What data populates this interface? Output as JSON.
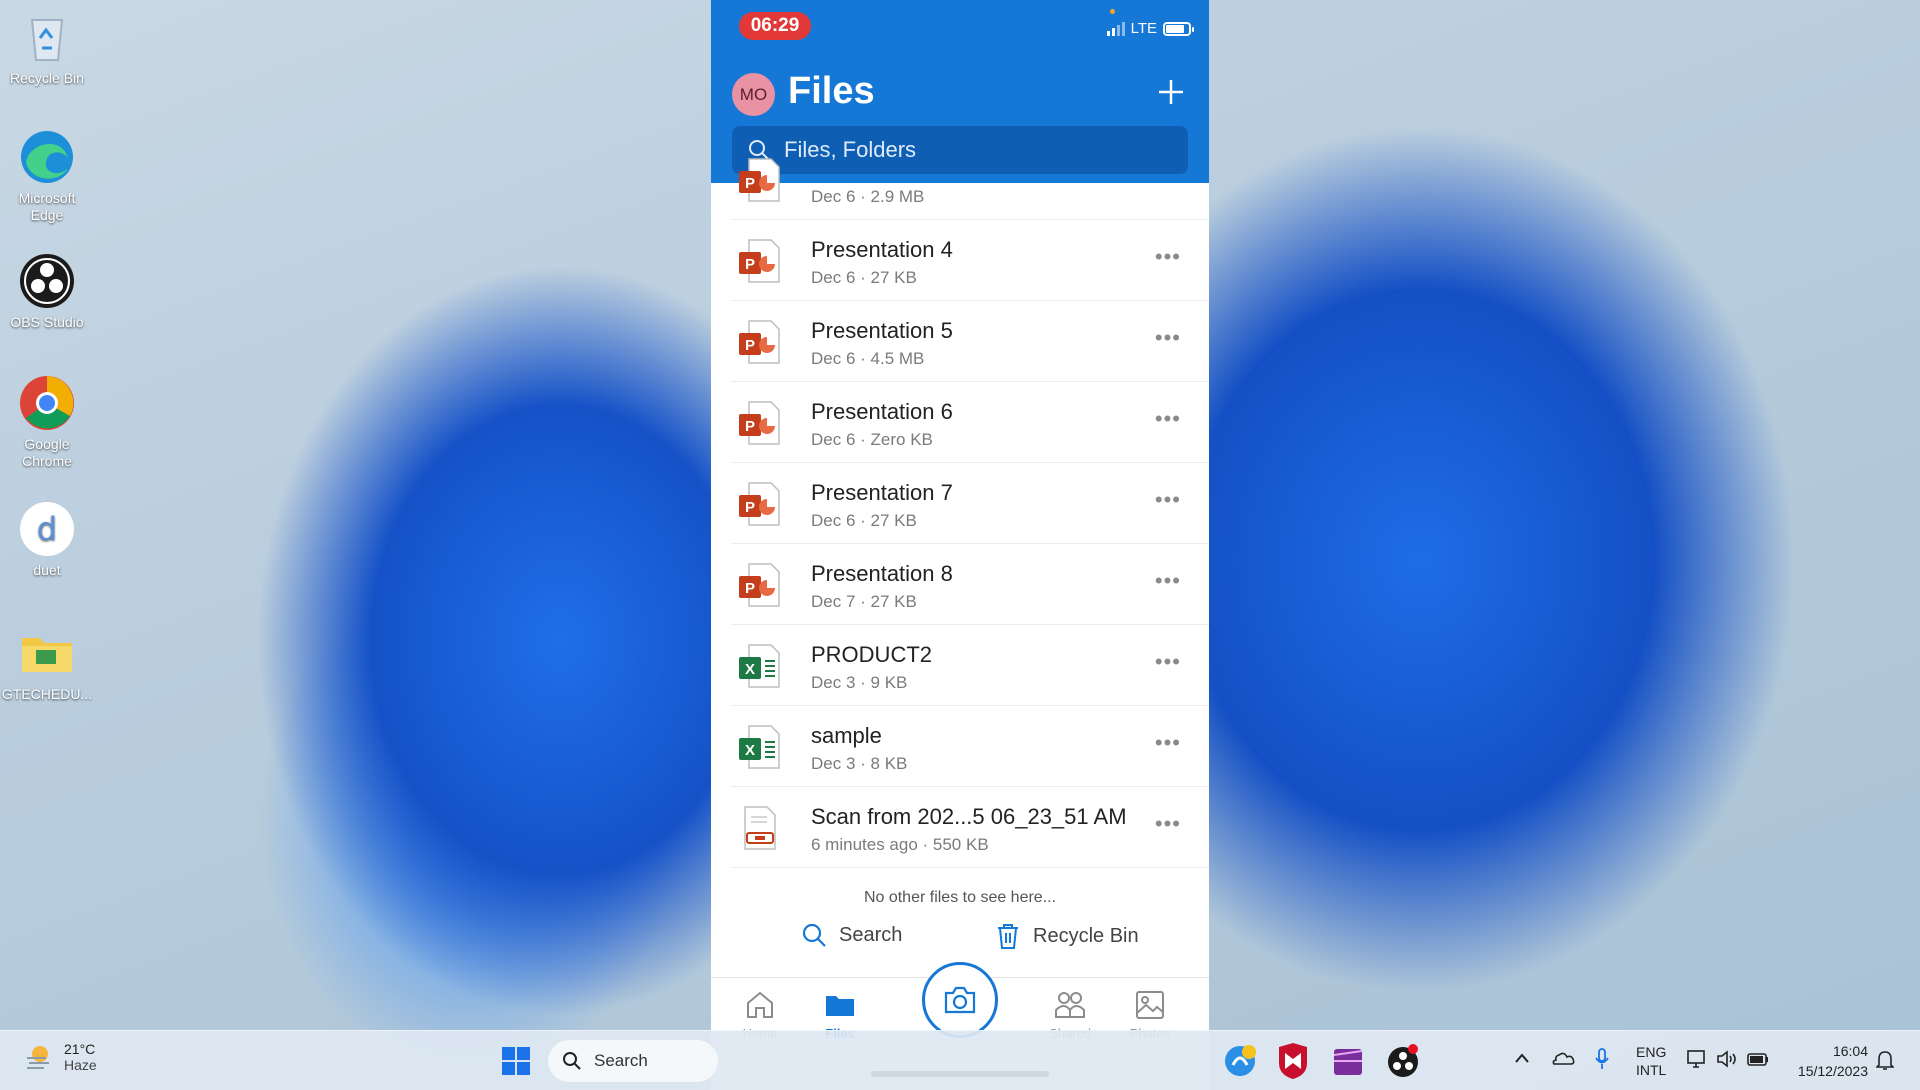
{
  "desktop": {
    "icons": [
      {
        "label": "Recycle Bin",
        "icon": "recycle-bin-icon"
      },
      {
        "label": "Microsoft Edge",
        "icon": "edge-icon"
      },
      {
        "label": "OBS Studio",
        "icon": "obs-icon"
      },
      {
        "label": "Google Chrome",
        "icon": "chrome-icon"
      },
      {
        "label": "duet",
        "icon": "duet-icon"
      },
      {
        "label": "GTECHEDU...",
        "icon": "folder-icon"
      }
    ]
  },
  "phone": {
    "status_time": "06:29",
    "network": "LTE",
    "avatar_initials": "MO",
    "title": "Files",
    "search_placeholder": "Files, Folders",
    "files": [
      {
        "name": "",
        "meta": "Dec 6 · 2.9 MB",
        "type": "powerpoint"
      },
      {
        "name": "Presentation 4",
        "meta": "Dec 6 · 27 KB",
        "type": "powerpoint"
      },
      {
        "name": "Presentation 5",
        "meta": "Dec 6 · 4.5 MB",
        "type": "powerpoint"
      },
      {
        "name": "Presentation 6",
        "meta": "Dec 6 · Zero KB",
        "type": "powerpoint"
      },
      {
        "name": "Presentation 7",
        "meta": "Dec 6 · 27 KB",
        "type": "powerpoint"
      },
      {
        "name": "Presentation 8",
        "meta": "Dec 7 · 27 KB",
        "type": "powerpoint"
      },
      {
        "name": "PRODUCT2",
        "meta": "Dec 3 · 9 KB",
        "type": "excel"
      },
      {
        "name": "sample",
        "meta": "Dec 3 · 8 KB",
        "type": "excel"
      },
      {
        "name": "Scan from 202...5 06_23_51 AM",
        "meta": "6 minutes ago · 550 KB",
        "type": "scan"
      }
    ],
    "empty_note": "No other files to see here...",
    "footer": {
      "search_label": "Search",
      "recycle_label": "Recycle Bin"
    },
    "tabs": [
      {
        "label": "Home",
        "icon": "home-icon",
        "active": false
      },
      {
        "label": "Files",
        "icon": "folder-icon",
        "active": true
      },
      {
        "label": "Shared",
        "icon": "shared-icon",
        "active": false
      },
      {
        "label": "Photos",
        "icon": "photo-icon",
        "active": false
      }
    ]
  },
  "taskbar": {
    "weather_temp": "21°C",
    "weather_desc": "Haze",
    "search_label": "Search",
    "lang_top": "ENG",
    "lang_bottom": "INTL",
    "time": "16:04",
    "date": "15/12/2023"
  },
  "colors": {
    "accent": "#1577d6",
    "powerpoint": "#c43e1c",
    "excel": "#1d7a45",
    "status_pill": "#e23838"
  }
}
